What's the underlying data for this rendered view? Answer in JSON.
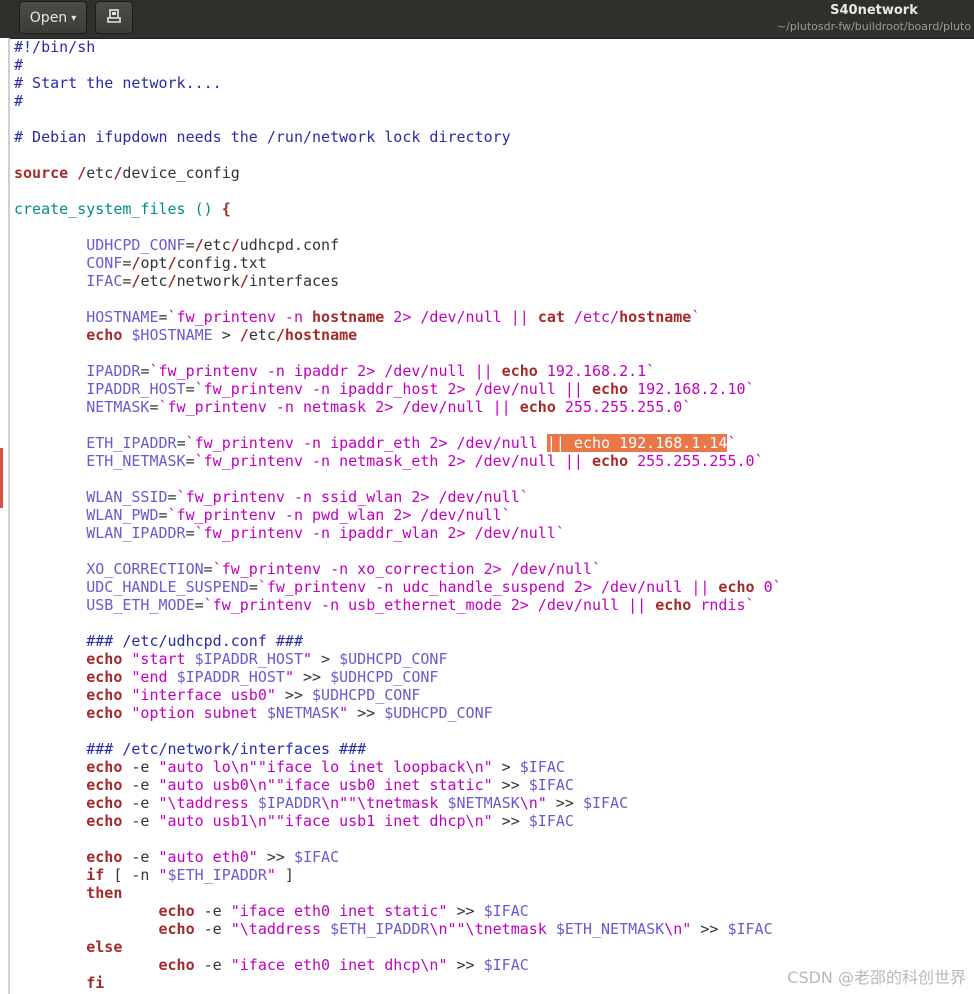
{
  "window": {
    "title": "S40network",
    "path": "~/plutosdr-fw/buildroot/board/pluto"
  },
  "toolbar": {
    "open_label": "Open",
    "open_caret_icon": "chevron-down-icon",
    "save_icon": "save-document-icon"
  },
  "colors": {
    "comment": "#2a2aa8",
    "keyword": "#a52a2a",
    "variable": "#6a5acd",
    "string": "#c000c0",
    "function": "#008b8b",
    "highlight": "#e9774a",
    "titlebar": "#2f2f2c"
  },
  "editor": {
    "lines": [
      [
        [
          "c",
          "#!/bin/sh"
        ]
      ],
      [
        [
          "c",
          "#"
        ]
      ],
      [
        [
          "c",
          "# Start the network...."
        ]
      ],
      [
        [
          "c",
          "#"
        ]
      ],
      [],
      [
        [
          "c",
          "# Debian ifupdown needs the /run/network lock directory"
        ]
      ],
      [],
      [
        [
          "k",
          "source"
        ],
        [
          "n",
          " "
        ],
        [
          "k",
          "/"
        ],
        [
          "n",
          "etc"
        ],
        [
          "k",
          "/"
        ],
        [
          "n",
          "device_config"
        ]
      ],
      [],
      [
        [
          "f",
          "create_system_files () "
        ],
        [
          "k",
          "{"
        ]
      ],
      [],
      [
        [
          "n",
          "        "
        ],
        [
          "v",
          "UDHCPD_CONF"
        ],
        [
          "n",
          "="
        ],
        [
          "k",
          "/"
        ],
        [
          "n",
          "etc"
        ],
        [
          "k",
          "/"
        ],
        [
          "n",
          "udhcpd.conf"
        ]
      ],
      [
        [
          "n",
          "        "
        ],
        [
          "v",
          "CONF"
        ],
        [
          "n",
          "="
        ],
        [
          "k",
          "/"
        ],
        [
          "n",
          "opt"
        ],
        [
          "k",
          "/"
        ],
        [
          "n",
          "config.txt"
        ]
      ],
      [
        [
          "n",
          "        "
        ],
        [
          "v",
          "IFAC"
        ],
        [
          "n",
          "="
        ],
        [
          "k",
          "/"
        ],
        [
          "n",
          "etc"
        ],
        [
          "k",
          "/"
        ],
        [
          "n",
          "network"
        ],
        [
          "k",
          "/"
        ],
        [
          "n",
          "interfaces"
        ]
      ],
      [],
      [
        [
          "n",
          "        "
        ],
        [
          "v",
          "HOSTNAME"
        ],
        [
          "n",
          "="
        ],
        [
          "s",
          "`fw_printenv -n "
        ],
        [
          "k",
          "hostname"
        ],
        [
          "s",
          " 2> /dev/null || "
        ],
        [
          "k",
          "cat"
        ],
        [
          "s",
          " /etc/"
        ],
        [
          "k",
          "hostname"
        ],
        [
          "s",
          "`"
        ]
      ],
      [
        [
          "n",
          "        "
        ],
        [
          "k",
          "echo"
        ],
        [
          "n",
          " "
        ],
        [
          "v",
          "$HOSTNAME"
        ],
        [
          "n",
          " > "
        ],
        [
          "k",
          "/"
        ],
        [
          "n",
          "etc"
        ],
        [
          "k",
          "/hostname"
        ]
      ],
      [],
      [
        [
          "n",
          "        "
        ],
        [
          "v",
          "IPADDR"
        ],
        [
          "n",
          "="
        ],
        [
          "s",
          "`fw_printenv -n ipaddr 2> /dev/null || "
        ],
        [
          "k",
          "echo"
        ],
        [
          "s",
          " 192.168.2.1`"
        ]
      ],
      [
        [
          "n",
          "        "
        ],
        [
          "v",
          "IPADDR_HOST"
        ],
        [
          "n",
          "="
        ],
        [
          "s",
          "`fw_printenv -n ipaddr_host 2> /dev/null || "
        ],
        [
          "k",
          "echo"
        ],
        [
          "s",
          " 192.168.2.10`"
        ]
      ],
      [
        [
          "n",
          "        "
        ],
        [
          "v",
          "NETMASK"
        ],
        [
          "n",
          "="
        ],
        [
          "s",
          "`fw_printenv -n netmask 2> /dev/null || "
        ],
        [
          "k",
          "echo"
        ],
        [
          "s",
          " 255.255.255.0`"
        ]
      ],
      [],
      [
        [
          "n",
          "        "
        ],
        [
          "v",
          "ETH_IPADDR"
        ],
        [
          "n",
          "="
        ],
        [
          "s",
          "`fw_printenv -n ipaddr_eth 2> /dev/null "
        ],
        [
          "hl",
          "|| echo 192.168.1.14"
        ],
        [
          "s",
          "`"
        ]
      ],
      [
        [
          "n",
          "        "
        ],
        [
          "v",
          "ETH_NETMASK"
        ],
        [
          "n",
          "="
        ],
        [
          "s",
          "`fw_printenv -n netmask_eth 2> /dev/null || "
        ],
        [
          "k",
          "echo"
        ],
        [
          "s",
          " 255.255.255.0`"
        ]
      ],
      [],
      [
        [
          "n",
          "        "
        ],
        [
          "v",
          "WLAN_SSID"
        ],
        [
          "n",
          "="
        ],
        [
          "s",
          "`fw_printenv -n ssid_wlan 2> /dev/null`"
        ]
      ],
      [
        [
          "n",
          "        "
        ],
        [
          "v",
          "WLAN_PWD"
        ],
        [
          "n",
          "="
        ],
        [
          "s",
          "`fw_printenv -n pwd_wlan 2> /dev/null`"
        ]
      ],
      [
        [
          "n",
          "        "
        ],
        [
          "v",
          "WLAN_IPADDR"
        ],
        [
          "n",
          "="
        ],
        [
          "s",
          "`fw_printenv -n ipaddr_wlan 2> /dev/null`"
        ]
      ],
      [],
      [
        [
          "n",
          "        "
        ],
        [
          "v",
          "XO_CORRECTION"
        ],
        [
          "n",
          "="
        ],
        [
          "s",
          "`fw_printenv -n xo_correction 2> /dev/null`"
        ]
      ],
      [
        [
          "n",
          "        "
        ],
        [
          "v",
          "UDC_HANDLE_SUSPEND"
        ],
        [
          "n",
          "="
        ],
        [
          "s",
          "`fw_printenv -n udc_handle_suspend 2> /dev/null || "
        ],
        [
          "k",
          "echo"
        ],
        [
          "s",
          " 0`"
        ]
      ],
      [
        [
          "n",
          "        "
        ],
        [
          "v",
          "USB_ETH_MODE"
        ],
        [
          "n",
          "="
        ],
        [
          "s",
          "`fw_printenv -n usb_ethernet_mode 2> /dev/null || "
        ],
        [
          "k",
          "echo"
        ],
        [
          "s",
          " rndis`"
        ]
      ],
      [],
      [
        [
          "n",
          "        "
        ],
        [
          "c",
          "### /etc/udhcpd.conf ###"
        ]
      ],
      [
        [
          "n",
          "        "
        ],
        [
          "k",
          "echo"
        ],
        [
          "n",
          " "
        ],
        [
          "s",
          "\"start "
        ],
        [
          "v",
          "$IPADDR_HOST"
        ],
        [
          "s",
          "\""
        ],
        [
          "n",
          " > "
        ],
        [
          "v",
          "$UDHCPD_CONF"
        ]
      ],
      [
        [
          "n",
          "        "
        ],
        [
          "k",
          "echo"
        ],
        [
          "n",
          " "
        ],
        [
          "s",
          "\"end "
        ],
        [
          "v",
          "$IPADDR_HOST"
        ],
        [
          "s",
          "\""
        ],
        [
          "n",
          " >> "
        ],
        [
          "v",
          "$UDHCPD_CONF"
        ]
      ],
      [
        [
          "n",
          "        "
        ],
        [
          "k",
          "echo"
        ],
        [
          "n",
          " "
        ],
        [
          "s",
          "\"interface usb0\""
        ],
        [
          "n",
          " >> "
        ],
        [
          "v",
          "$UDHCPD_CONF"
        ]
      ],
      [
        [
          "n",
          "        "
        ],
        [
          "k",
          "echo"
        ],
        [
          "n",
          " "
        ],
        [
          "s",
          "\"option subnet "
        ],
        [
          "v",
          "$NETMASK"
        ],
        [
          "s",
          "\""
        ],
        [
          "n",
          " >> "
        ],
        [
          "v",
          "$UDHCPD_CONF"
        ]
      ],
      [],
      [
        [
          "n",
          "        "
        ],
        [
          "c",
          "### /etc/network/interfaces ###"
        ]
      ],
      [
        [
          "n",
          "        "
        ],
        [
          "k",
          "echo"
        ],
        [
          "n",
          " -e "
        ],
        [
          "s",
          "\"auto lo\\n\"\"iface lo inet loopback\\n\""
        ],
        [
          "n",
          " > "
        ],
        [
          "v",
          "$IFAC"
        ]
      ],
      [
        [
          "n",
          "        "
        ],
        [
          "k",
          "echo"
        ],
        [
          "n",
          " -e "
        ],
        [
          "s",
          "\"auto usb0\\n\"\"iface usb0 inet static\""
        ],
        [
          "n",
          " >> "
        ],
        [
          "v",
          "$IFAC"
        ]
      ],
      [
        [
          "n",
          "        "
        ],
        [
          "k",
          "echo"
        ],
        [
          "n",
          " -e "
        ],
        [
          "s",
          "\"\\taddress "
        ],
        [
          "v",
          "$IPADDR"
        ],
        [
          "s",
          "\\n\"\"\\tnetmask "
        ],
        [
          "v",
          "$NETMASK"
        ],
        [
          "s",
          "\\n\""
        ],
        [
          "n",
          " >> "
        ],
        [
          "v",
          "$IFAC"
        ]
      ],
      [
        [
          "n",
          "        "
        ],
        [
          "k",
          "echo"
        ],
        [
          "n",
          " -e "
        ],
        [
          "s",
          "\"auto usb1\\n\"\"iface usb1 inet dhcp\\n\""
        ],
        [
          "n",
          " >> "
        ],
        [
          "v",
          "$IFAC"
        ]
      ],
      [],
      [
        [
          "n",
          "        "
        ],
        [
          "k",
          "echo"
        ],
        [
          "n",
          " -e "
        ],
        [
          "s",
          "\"auto eth0\""
        ],
        [
          "n",
          " >> "
        ],
        [
          "v",
          "$IFAC"
        ]
      ],
      [
        [
          "n",
          "        "
        ],
        [
          "k",
          "if"
        ],
        [
          "n",
          " [ -n "
        ],
        [
          "s",
          "\""
        ],
        [
          "v",
          "$ETH_IPADDR"
        ],
        [
          "s",
          "\""
        ],
        [
          "n",
          " ]"
        ]
      ],
      [
        [
          "n",
          "        "
        ],
        [
          "k",
          "then"
        ]
      ],
      [
        [
          "n",
          "                "
        ],
        [
          "k",
          "echo"
        ],
        [
          "n",
          " -e "
        ],
        [
          "s",
          "\"iface eth0 inet static\""
        ],
        [
          "n",
          " >> "
        ],
        [
          "v",
          "$IFAC"
        ]
      ],
      [
        [
          "n",
          "                "
        ],
        [
          "k",
          "echo"
        ],
        [
          "n",
          " -e "
        ],
        [
          "s",
          "\"\\taddress "
        ],
        [
          "v",
          "$ETH_IPADDR"
        ],
        [
          "s",
          "\\n\"\"\\tnetmask "
        ],
        [
          "v",
          "$ETH_NETMASK"
        ],
        [
          "s",
          "\\n\""
        ],
        [
          "n",
          " >> "
        ],
        [
          "v",
          "$IFAC"
        ]
      ],
      [
        [
          "n",
          "        "
        ],
        [
          "k",
          "else"
        ]
      ],
      [
        [
          "n",
          "                "
        ],
        [
          "k",
          "echo"
        ],
        [
          "n",
          " -e "
        ],
        [
          "s",
          "\"iface eth0 inet dhcp\\n\""
        ],
        [
          "n",
          " >> "
        ],
        [
          "v",
          "$IFAC"
        ]
      ],
      [
        [
          "n",
          "        "
        ],
        [
          "k",
          "fi"
        ]
      ]
    ]
  },
  "watermark": "CSDN @老邵的科创世界"
}
